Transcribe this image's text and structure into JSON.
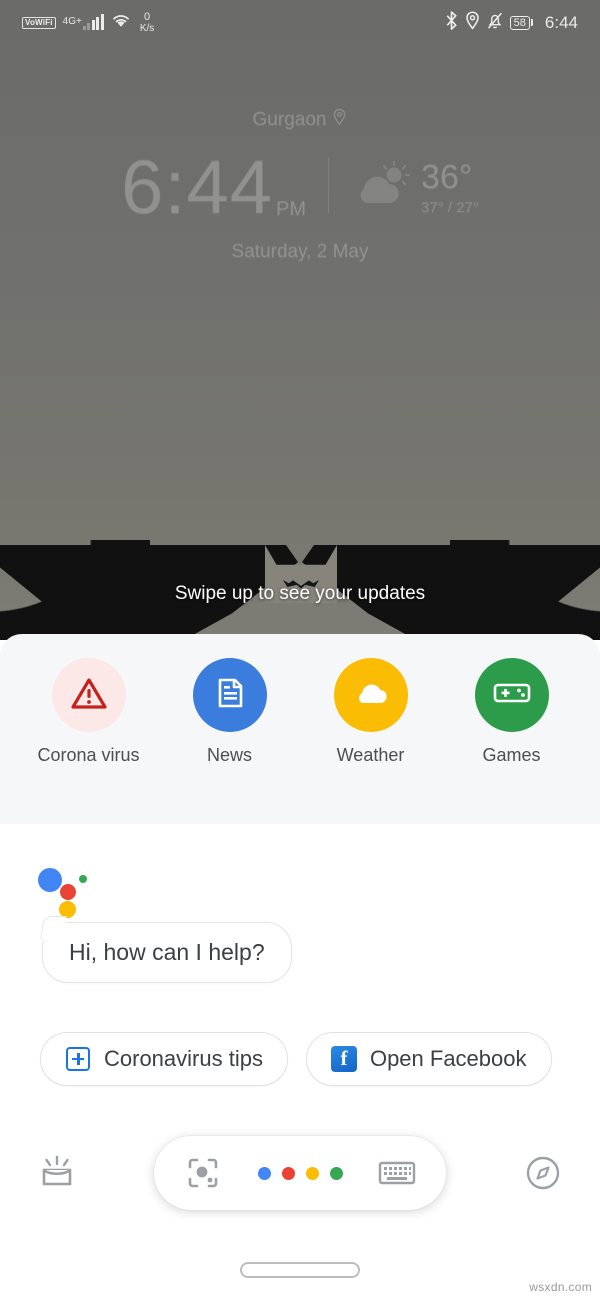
{
  "statusbar": {
    "vowifi": "VoWiFi",
    "network": "4G+",
    "data_rate_value": "0",
    "data_rate_unit": "K/s",
    "icons": [
      "bluetooth-icon",
      "location-icon",
      "alarm-muted-icon"
    ],
    "battery_percent": "58",
    "clock": "6:44"
  },
  "widget": {
    "location": "Gurgaon",
    "location_icon": "location-pin-icon",
    "hour": "6",
    "separator": ":",
    "minute": "44",
    "ampm": "PM",
    "weather_icon": "partly-cloudy-icon",
    "temp_now": "36°",
    "temp_range": "37° / 27°",
    "date": "Saturday, 2 May"
  },
  "swipe_hint": "Swipe up to see your updates",
  "shortcuts": [
    {
      "label": "Corona virus",
      "icon": "warning-triangle-icon",
      "bubble_color": "#fce8e6",
      "icon_color": "#c5221f"
    },
    {
      "label": "News",
      "icon": "document-icon",
      "bubble_color": "#3b7ddd",
      "icon_color": "#ffffff"
    },
    {
      "label": "Weather",
      "icon": "cloud-icon",
      "bubble_color": "#fbbc04",
      "icon_color": "#ffffff"
    },
    {
      "label": "Games",
      "icon": "gamepad-icon",
      "bubble_color": "#2d9c4a",
      "icon_color": "#ffffff"
    }
  ],
  "assistant": {
    "logo": "google-assistant-dots",
    "greeting": "Hi, how can I help?",
    "chips": [
      {
        "label": "Coronavirus tips",
        "icon": "medical-plus-icon"
      },
      {
        "label": "Open Facebook",
        "icon": "facebook-icon"
      }
    ]
  },
  "bottombar": {
    "left_icon": "snapshot-updates-icon",
    "lens_icon": "google-lens-icon",
    "mic_dots": [
      "#4285f4",
      "#ea4335",
      "#fbbc05",
      "#34a853"
    ],
    "keyboard_icon": "keyboard-icon",
    "right_icon": "explore-compass-icon"
  },
  "navbar": {
    "home_indicator": "home-pill-indicator"
  },
  "watermark": "wsxdn.com",
  "colors": {
    "google_blue": "#4285f4",
    "google_red": "#ea4335",
    "google_yellow": "#fbbc05",
    "google_green": "#34a853",
    "sheet_bg": "#f6f7f9",
    "wallpaper": "#6e6e6c"
  }
}
